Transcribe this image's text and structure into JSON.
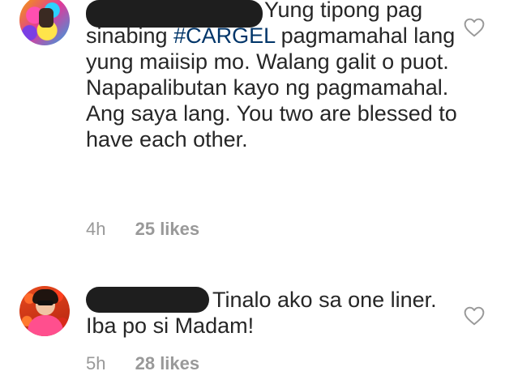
{
  "comments": [
    {
      "text_prefix": "Yung tipong pag sinabing ",
      "hashtag": "#CARGEL",
      "text_suffix": " pagmamahal lang yung maiisip mo. Walang galit o puot. Napapalibutan kayo ng pagmamahal. Ang saya lang. You two are blessed to have each other.",
      "time": "4h",
      "likes": "25 likes"
    },
    {
      "text_prefix": "Tinalo ako sa one liner. Iba po si Madam!",
      "hashtag": "",
      "text_suffix": "",
      "time": "5h",
      "likes": "28 likes"
    }
  ],
  "icons": {
    "like": "heart-outline-icon"
  },
  "colors": {
    "text": "#262626",
    "hashtag": "#003569",
    "meta": "#999999",
    "heart_stroke": "#999999"
  }
}
